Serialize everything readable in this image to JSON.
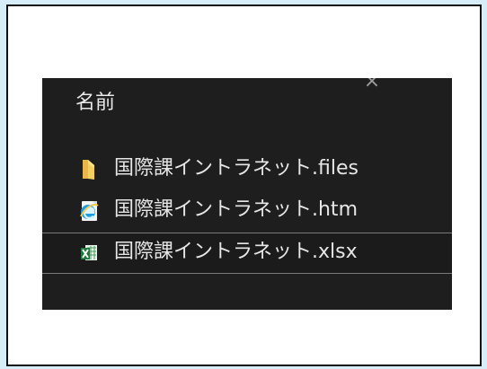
{
  "window": {
    "close_symbol": "×",
    "background_color": "#1e1e1e",
    "outer_background": "#d7edf8"
  },
  "file_list": {
    "column_header": "名前",
    "items": [
      {
        "name": "国際課イントラネット.files",
        "icon": "folder-icon",
        "selected": false
      },
      {
        "name": "国際課イントラネット.htm",
        "icon": "internet-explorer-html-icon",
        "selected": false
      },
      {
        "name": "国際課イントラネット.xlsx",
        "icon": "excel-file-icon",
        "selected": true
      }
    ]
  }
}
